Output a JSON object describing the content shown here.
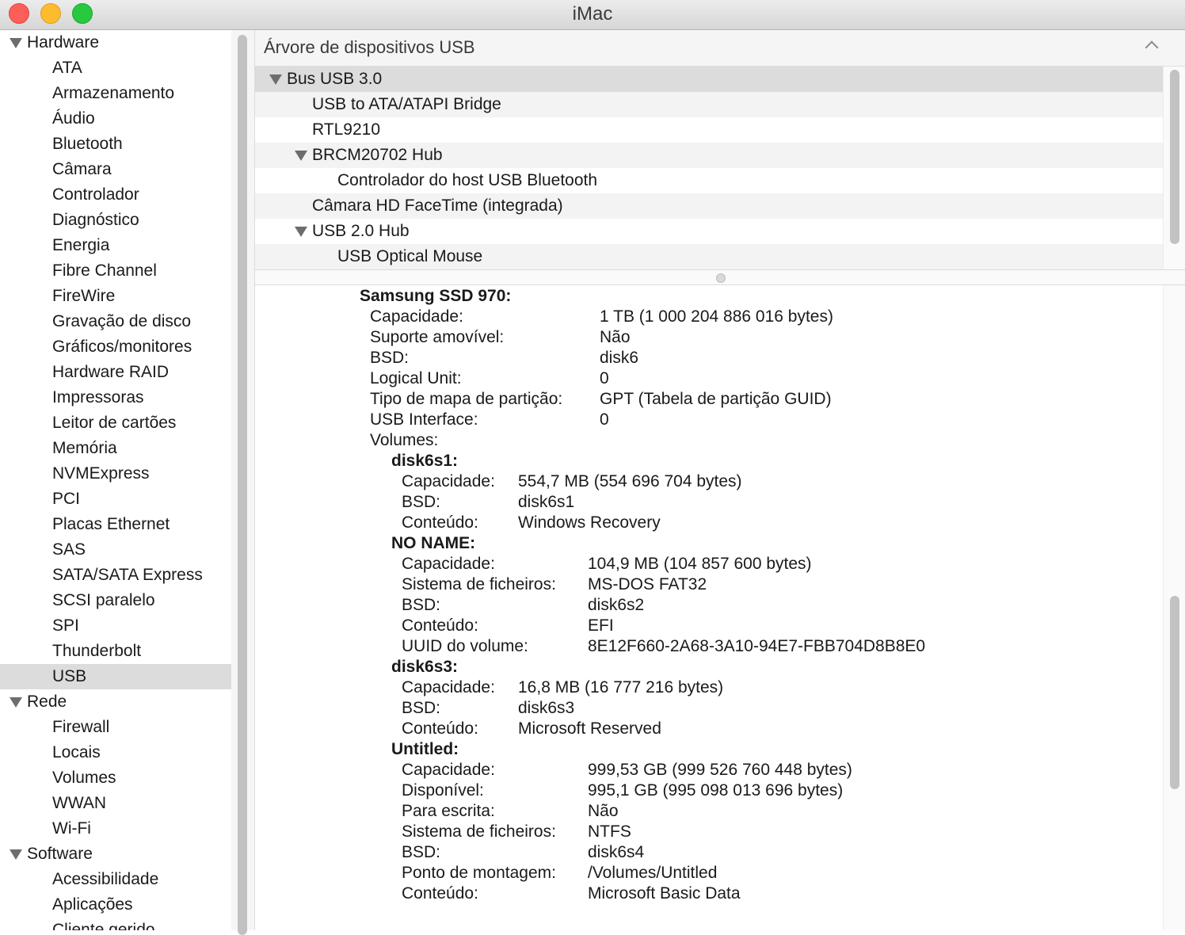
{
  "window": {
    "title": "iMac"
  },
  "sidebar": {
    "rows": [
      {
        "type": "group",
        "label": "Hardware"
      },
      {
        "type": "item",
        "label": "ATA"
      },
      {
        "type": "item",
        "label": "Armazenamento"
      },
      {
        "type": "item",
        "label": "Áudio"
      },
      {
        "type": "item",
        "label": "Bluetooth"
      },
      {
        "type": "item",
        "label": "Câmara"
      },
      {
        "type": "item",
        "label": "Controlador"
      },
      {
        "type": "item",
        "label": "Diagnóstico"
      },
      {
        "type": "item",
        "label": "Energia"
      },
      {
        "type": "item",
        "label": "Fibre Channel"
      },
      {
        "type": "item",
        "label": "FireWire"
      },
      {
        "type": "item",
        "label": "Gravação de disco"
      },
      {
        "type": "item",
        "label": "Gráficos/monitores"
      },
      {
        "type": "item",
        "label": "Hardware RAID"
      },
      {
        "type": "item",
        "label": "Impressoras"
      },
      {
        "type": "item",
        "label": "Leitor de cartões"
      },
      {
        "type": "item",
        "label": "Memória"
      },
      {
        "type": "item",
        "label": "NVMExpress"
      },
      {
        "type": "item",
        "label": "PCI"
      },
      {
        "type": "item",
        "label": "Placas Ethernet"
      },
      {
        "type": "item",
        "label": "SAS"
      },
      {
        "type": "item",
        "label": "SATA/SATA Express"
      },
      {
        "type": "item",
        "label": "SCSI paralelo"
      },
      {
        "type": "item",
        "label": "SPI"
      },
      {
        "type": "item",
        "label": "Thunderbolt"
      },
      {
        "type": "item",
        "label": "USB",
        "selected": true
      },
      {
        "type": "group",
        "label": "Rede"
      },
      {
        "type": "item",
        "label": "Firewall"
      },
      {
        "type": "item",
        "label": "Locais"
      },
      {
        "type": "item",
        "label": "Volumes"
      },
      {
        "type": "item",
        "label": "WWAN"
      },
      {
        "type": "item",
        "label": "Wi-Fi"
      },
      {
        "type": "group",
        "label": "Software"
      },
      {
        "type": "item",
        "label": "Acessibilidade"
      },
      {
        "type": "item",
        "label": "Aplicações"
      },
      {
        "type": "item",
        "label": "Cliente gerido"
      }
    ]
  },
  "section": {
    "title": "Árvore de dispositivos USB"
  },
  "tree": [
    {
      "label": "Bus USB 3.0",
      "level": 0,
      "expanded": true,
      "selected": true
    },
    {
      "label": "USB to ATA/ATAPI Bridge",
      "level": 1
    },
    {
      "label": "RTL9210",
      "level": 1
    },
    {
      "label": "BRCM20702 Hub",
      "level": 1,
      "expanded": true
    },
    {
      "label": "Controlador do host USB Bluetooth",
      "level": 2
    },
    {
      "label": "Câmara HD FaceTime (integrada)",
      "level": 1
    },
    {
      "label": "USB 2.0 Hub",
      "level": 1,
      "expanded": true
    },
    {
      "label": "USB Optical Mouse",
      "level": 2
    }
  ],
  "detail": {
    "device_title": "Samsung SSD 970:",
    "device_props": [
      {
        "key": "Capacidade:",
        "value": "1 TB (1 000 204 886 016 bytes)"
      },
      {
        "key": "Suporte amovível:",
        "value": "Não"
      },
      {
        "key": "BSD:",
        "value": "disk6"
      },
      {
        "key": "Logical Unit:",
        "value": "0"
      },
      {
        "key": "Tipo de mapa de partição:",
        "value": "GPT (Tabela de partição GUID)"
      },
      {
        "key": "USB Interface:",
        "value": "0"
      }
    ],
    "volumes_label": "Volumes:",
    "volumes": [
      {
        "name": "disk6s1:",
        "props": [
          {
            "key": "Capacidade:",
            "value": "554,7 MB (554 696 704 bytes)"
          },
          {
            "key": "BSD:",
            "value": "disk6s1"
          },
          {
            "key": "Conteúdo:",
            "value": "Windows Recovery"
          }
        ]
      },
      {
        "name": "NO NAME:",
        "props": [
          {
            "key": "Capacidade:",
            "value": "104,9 MB (104 857 600 bytes)"
          },
          {
            "key": "Sistema de ficheiros:",
            "value": "MS-DOS FAT32"
          },
          {
            "key": "BSD:",
            "value": "disk6s2"
          },
          {
            "key": "Conteúdo:",
            "value": "EFI"
          },
          {
            "key": "UUID do volume:",
            "value": "8E12F660-2A68-3A10-94E7-FBB704D8B8E0"
          }
        ]
      },
      {
        "name": "disk6s3:",
        "props": [
          {
            "key": "Capacidade:",
            "value": "16,8 MB (16 777 216 bytes)"
          },
          {
            "key": "BSD:",
            "value": "disk6s3"
          },
          {
            "key": "Conteúdo:",
            "value": "Microsoft Reserved"
          }
        ]
      },
      {
        "name": "Untitled:",
        "props": [
          {
            "key": "Capacidade:",
            "value": "999,53 GB (999 526 760 448 bytes)"
          },
          {
            "key": "Disponível:",
            "value": "995,1 GB (995 098 013 696 bytes)"
          },
          {
            "key": "Para escrita:",
            "value": "Não"
          },
          {
            "key": "Sistema de ficheiros:",
            "value": "NTFS"
          },
          {
            "key": "BSD:",
            "value": "disk6s4"
          },
          {
            "key": "Ponto de montagem:",
            "value": "/Volumes/Untitled"
          },
          {
            "key": "Conteúdo:",
            "value": "Microsoft Basic Data"
          }
        ]
      }
    ]
  }
}
